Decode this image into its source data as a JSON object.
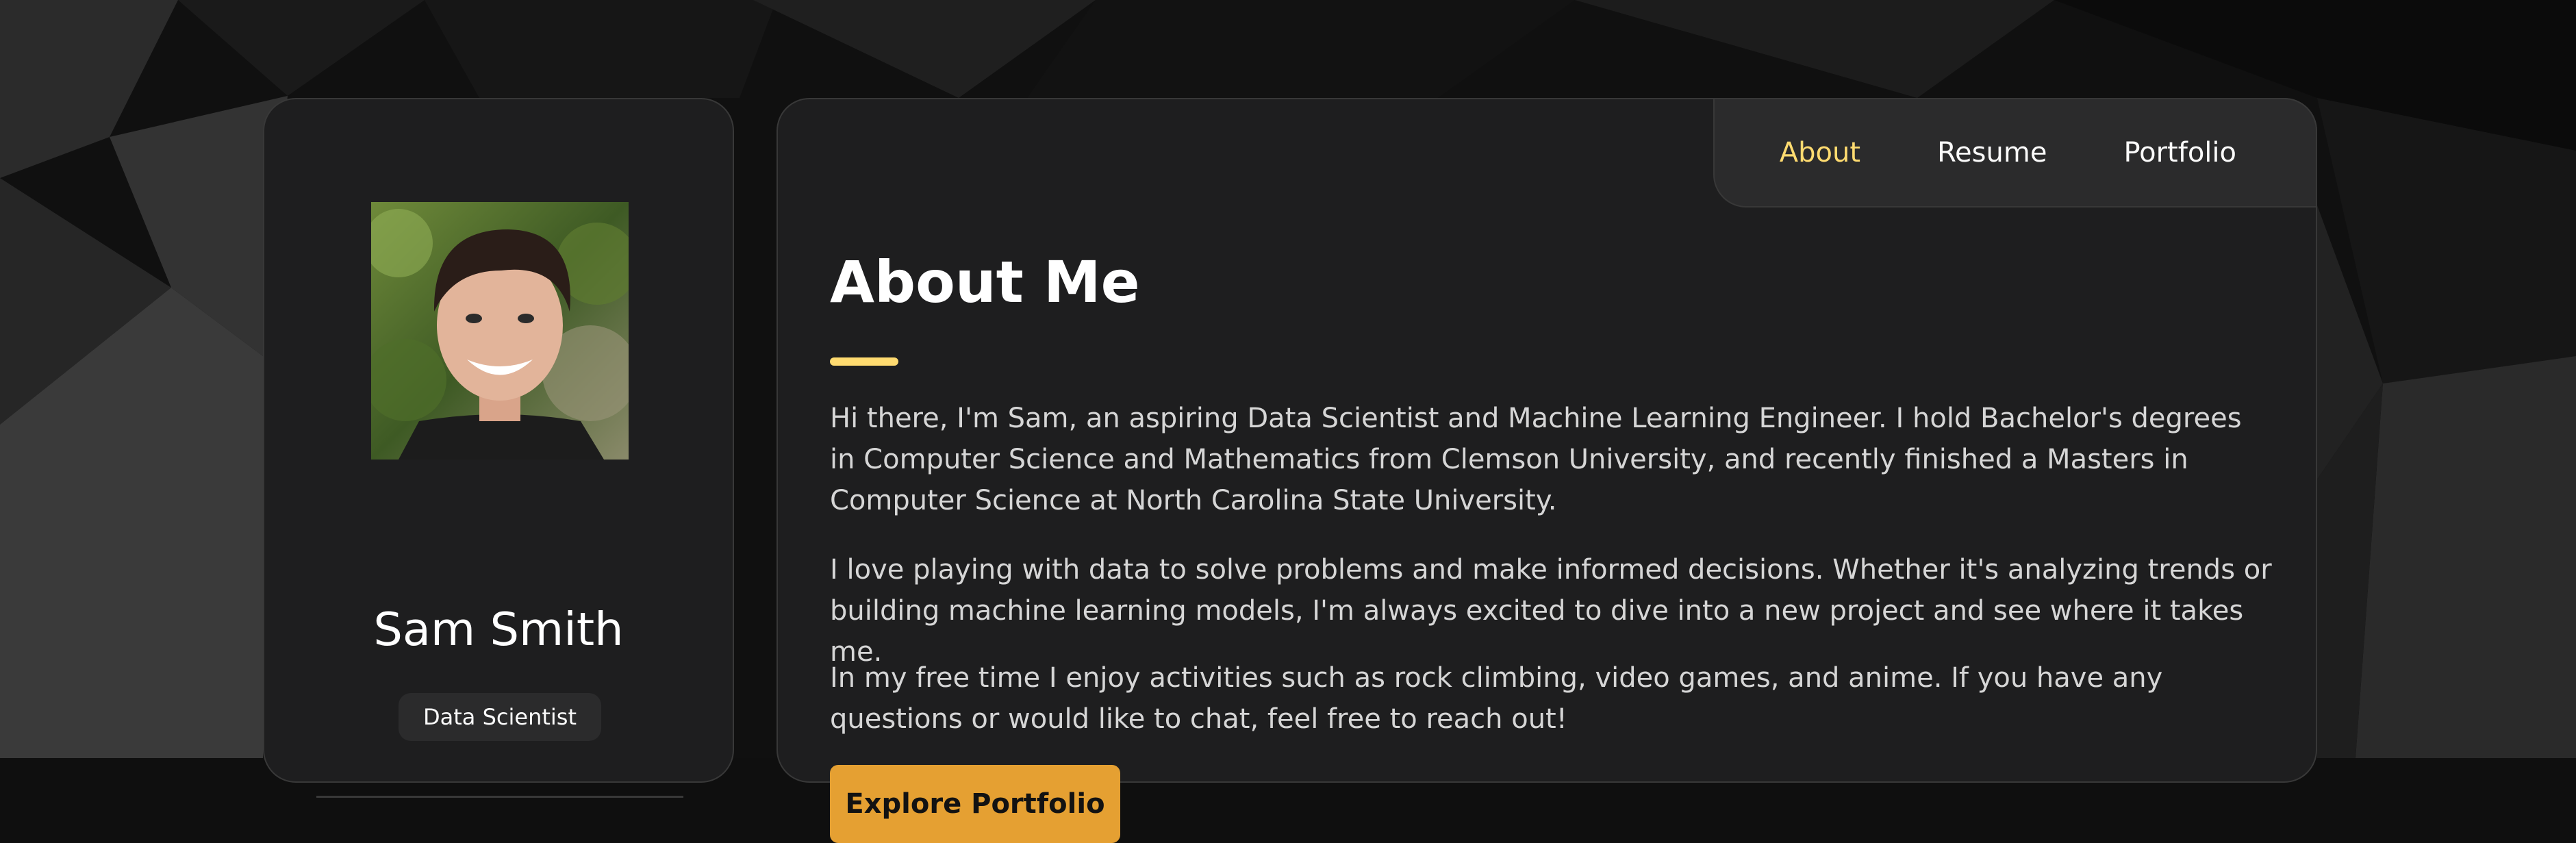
{
  "profile": {
    "name": "Sam Smith",
    "role": "Data Scientist",
    "photo_alt": "Sam Smith"
  },
  "nav": {
    "items": [
      {
        "label": "About",
        "active": true
      },
      {
        "label": "Resume",
        "active": false
      },
      {
        "label": "Portfolio",
        "active": false
      }
    ]
  },
  "about": {
    "title": "About Me",
    "paragraphs": [
      "Hi there, I'm Sam, an aspiring Data Scientist and Machine Learning Engineer. I hold Bachelor's degrees in Computer Science and Mathematics from Clemson University, and recently finished a Masters in Computer Science at North Carolina State University.",
      "I love playing with data to solve problems and make informed decisions. Whether it's analyzing trends or building machine learning models, I'm always excited to dive into a new project and see where it takes me.",
      "In my free time I enjoy activities such as rock climbing, video games, and anime. If you have any questions or would like to chat, feel free to reach out!"
    ],
    "cta_label": "Explore Portfolio"
  },
  "colors": {
    "accent": "#ffdb70",
    "button": "#e5a032",
    "card": "#1e1e1f",
    "border": "#383838"
  }
}
